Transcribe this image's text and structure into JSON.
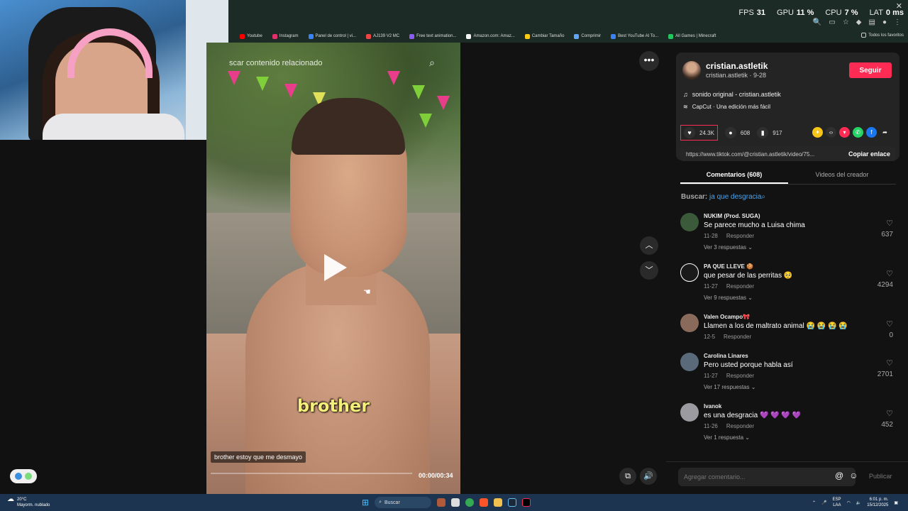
{
  "browser": {
    "perf": [
      {
        "label": "FPS",
        "value": "31"
      },
      {
        "label": "GPU",
        "value": "11 %"
      },
      {
        "label": "CPU",
        "value": "7 %"
      },
      {
        "label": "LAT",
        "value": "0 ms"
      }
    ],
    "bookmarks": [
      {
        "label": "Youtube",
        "color": "#ff0000"
      },
      {
        "label": "Instagram",
        "color": "#e1306c"
      },
      {
        "label": "Panel de control | vi...",
        "color": "#3b82f6"
      },
      {
        "label": "AJ139 V2 MC",
        "color": "#ef4444"
      },
      {
        "label": "Free text animation...",
        "color": "#8b5cf6"
      },
      {
        "label": "Amazon.com: Amaz...",
        "color": "#f5f5f5"
      },
      {
        "label": "Cambiar Tamaño",
        "color": "#facc15"
      },
      {
        "label": "Comprimir",
        "color": "#60a5fa"
      },
      {
        "label": "Best YouTube AI To...",
        "color": "#3b82f6"
      },
      {
        "label": "All Games | Minecraft",
        "color": "#22c55e"
      }
    ],
    "all_bookmarks": "Todos los favoritos"
  },
  "video": {
    "search_placeholder": "scar contenido relacionado",
    "subtitle": "brother",
    "caption": "brother estoy que me desmayo",
    "time": "00:00/00:34",
    "progress": 0.0
  },
  "creator": {
    "username": "cristian.astletik",
    "sub": "cristian.astletik · 9-28",
    "follow_label": "Seguir",
    "sound": "sonido original - cristian.astletik",
    "capcut": "CapCut · Una edición más fácil"
  },
  "stats": {
    "likes": "24.3K",
    "comments": "608",
    "saves": "917"
  },
  "share_link": {
    "url": "https://www.tiktok.com/@cristian.astletik/video/75...",
    "copy_label": "Copiar enlace"
  },
  "tabs": [
    {
      "label": "Comentarios (608)",
      "active": true
    },
    {
      "label": "Videos del creador",
      "active": false
    }
  ],
  "search": {
    "prefix": "Buscar:",
    "term": "ja que desgracia"
  },
  "comments": [
    {
      "name": "NUKIM (Prod. SUGA)",
      "text": "Se parece mucho a Luisa chima",
      "date": "11-28",
      "reply": "Responder",
      "replies": "Ver 3 respuestas",
      "likes": "637"
    },
    {
      "name": "PA QUE LLEVE 🍪",
      "text": "que pesar de las perritas 🥺",
      "date": "11-27",
      "reply": "Responder",
      "replies": "Ver 9 respuestas",
      "likes": "4294"
    },
    {
      "name": "Valen Ocampo🎀",
      "text": "Llamen a los de maltrato animal 😭 😭 😭 😭",
      "date": "12-5",
      "reply": "Responder",
      "replies": "",
      "likes": "0"
    },
    {
      "name": "Carolina Linares",
      "text": "Pero usted porque habla así",
      "date": "11-27",
      "reply": "Responder",
      "replies": "Ver 17 respuestas",
      "likes": "2701"
    },
    {
      "name": "Ivanok",
      "text": "es una desgracia 💜 💜 💜 💜",
      "date": "11-26",
      "reply": "Responder",
      "replies": "Ver 1 respuesta",
      "likes": "452"
    }
  ],
  "add_comment": {
    "placeholder": "Agregar comentario...",
    "publish": "Publicar"
  },
  "taskbar": {
    "temp": "20°C",
    "weather": "Mayorm. nublado",
    "search": "Buscar",
    "lang1": "ESP",
    "lang2": "LAA",
    "time": "6:01 p. m.",
    "date": "15/12/2025"
  }
}
